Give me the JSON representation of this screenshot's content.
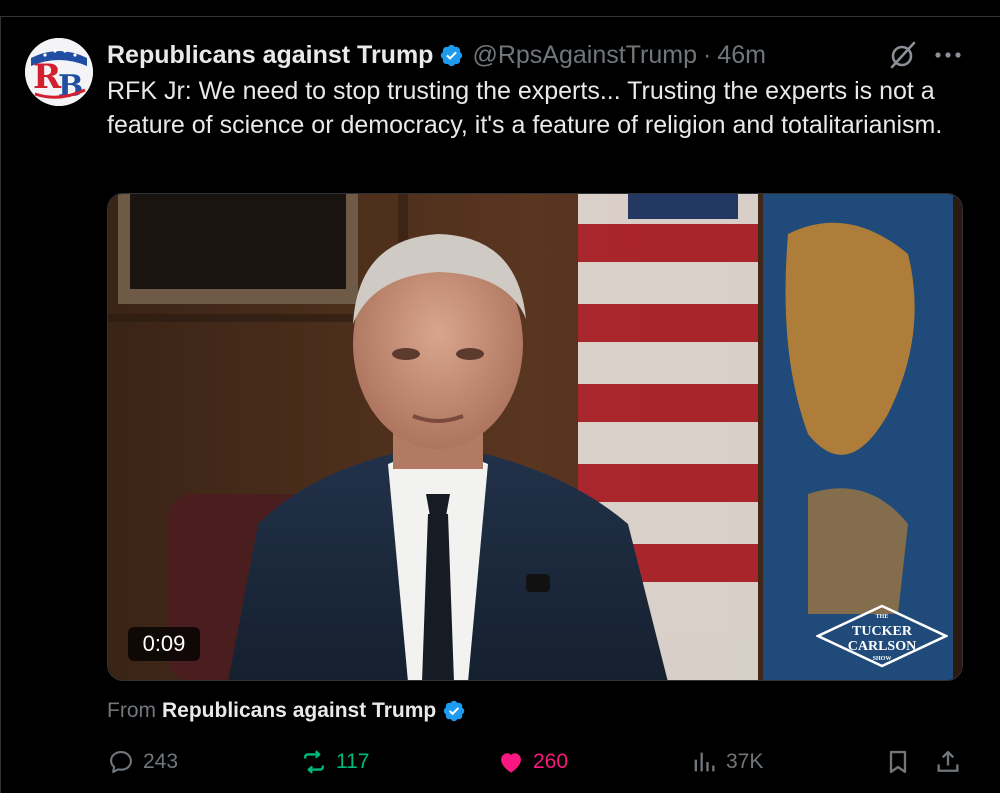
{
  "author": {
    "display_name": "Republicans against Trump",
    "handle": "@RpsAgainstTrump",
    "separator": "·",
    "time": "46m",
    "avatar_monogram": "RB",
    "avatar_colors": {
      "red": "#d3202e",
      "blue": "#1f4ea3"
    }
  },
  "tweet": {
    "text": "RFK Jr: We need to stop trusting the experts... Trusting the experts is not a feature of science or democracy, it's a feature of religion and totalitarianism."
  },
  "media": {
    "type": "video",
    "duration": "0:09",
    "watermark_lines": [
      "THE",
      "TUCKER",
      "CARLSON",
      "SHOW"
    ]
  },
  "attribution": {
    "prefix": "From",
    "name": "Republicans against Trump"
  },
  "metrics": {
    "replies": "243",
    "reposts": "117",
    "likes": "260",
    "views": "37K"
  },
  "icons": {
    "verified": "verified-badge-icon",
    "grok": "grok-icon",
    "more": "more-icon",
    "reply": "reply-icon",
    "repost": "repost-icon",
    "like": "heart-icon",
    "views": "views-icon",
    "bookmark": "bookmark-icon",
    "share": "share-icon"
  },
  "colors": {
    "background": "#000000",
    "text": "#e7e9ea",
    "muted": "#71767b",
    "verified": "#1d9bf0",
    "repost": "#00ba7c",
    "like": "#f91880"
  }
}
